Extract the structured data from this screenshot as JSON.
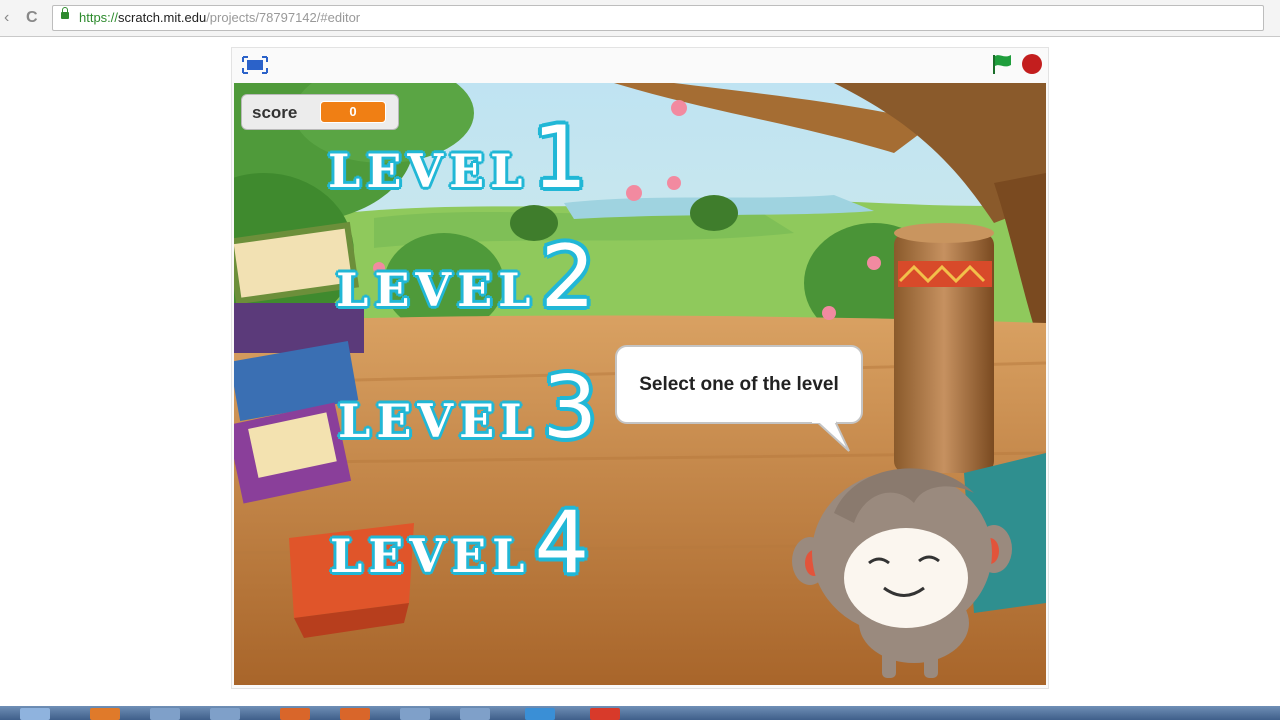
{
  "browser": {
    "back_glyph": "‹",
    "reload_glyph": "C",
    "url_scheme": "https://",
    "url_host": "scratch.mit.edu",
    "url_path": "/projects/78797142/#editor"
  },
  "stage_controls": {
    "fullscreen_icon": "fullscreen-icon",
    "flag_icon": "green-flag-icon",
    "stop_icon": "stop-icon",
    "flag_color": "#1f9e3c",
    "stop_color": "#c31e1e"
  },
  "score_monitor": {
    "label": "score",
    "value": "0"
  },
  "levels": [
    {
      "word": "LEVEL",
      "number": "1"
    },
    {
      "word": "LEVEL",
      "number": "2"
    },
    {
      "word": "LEVEL",
      "number": "3"
    },
    {
      "word": "LEVEL",
      "number": "4"
    }
  ],
  "speech_bubble": {
    "text": "Select one of the level"
  },
  "colors": {
    "level_outline": "#21b7d6",
    "score_orange": "#f07f14"
  }
}
